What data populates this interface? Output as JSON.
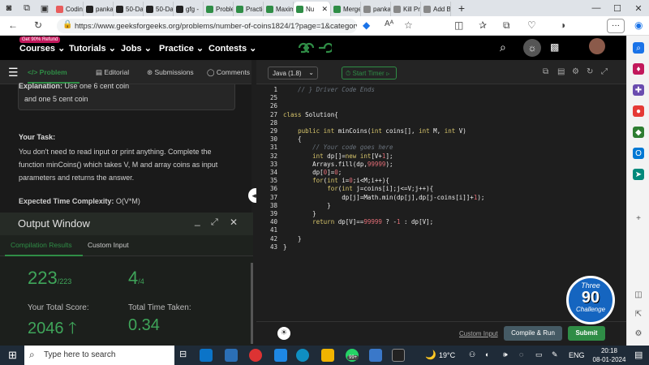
{
  "browser": {
    "tabs": [
      {
        "label": "Codin",
        "icon": "bookmark-icon",
        "color": "#e85c5c"
      },
      {
        "label": "panka",
        "icon": "github-icon",
        "color": "#222222"
      },
      {
        "label": "50-Da",
        "icon": "github-icon",
        "color": "#222222"
      },
      {
        "label": "50-Da",
        "icon": "github-icon",
        "color": "#222222"
      },
      {
        "label": "gfg - ",
        "icon": "github-icon",
        "color": "#222222"
      },
      {
        "label": "Proble",
        "icon": "gfg-icon",
        "color": "#2f8d46"
      },
      {
        "label": "Practic",
        "icon": "gfg-icon",
        "color": "#2f8d46"
      },
      {
        "label": "Maxim",
        "icon": "gfg-icon",
        "color": "#2f8d46"
      },
      {
        "label": "Nu",
        "icon": "gfg-icon",
        "color": "#2f8d46"
      },
      {
        "label": "Merge",
        "icon": "gfg-icon",
        "color": "#2f8d46"
      },
      {
        "label": "panka",
        "icon": "link-icon",
        "color": "#888888"
      },
      {
        "label": "Kill Pr",
        "icon": "link-icon",
        "color": "#888888"
      },
      {
        "label": "Add B",
        "icon": "link-icon",
        "color": "#888888"
      }
    ],
    "url": "https://www.geeksforgeeks.org/problems/number-of-coins1824/1?page=1&category=..."
  },
  "gfg": {
    "promo_badge": "Get 90% Refund",
    "nav": [
      "Courses",
      "Tutorials",
      "Jobs",
      "Practice",
      "Contests"
    ]
  },
  "left": {
    "tabs": [
      "Problem",
      "Editorial",
      "Submissions",
      "Comments"
    ],
    "explanation_label": "Explanation:",
    "explanation_text": "Use one 6 cent coin",
    "explanation_line2": "and one 5 cent coin",
    "your_task_heading": "Your Task:",
    "task_lines": [
      "You don't need to read input or print anything. Complete the",
      "function minCoins() which takes V, M and array coins as input",
      "parameters and returns the answer."
    ],
    "complexity_label": "Expected Time Complexity:",
    "complexity_value": "O(V*M)"
  },
  "output": {
    "title": "Output Window",
    "tabs": [
      "Compilation Results",
      "Custom Input"
    ],
    "tests_passed": "223",
    "tests_total": "/223",
    "attempts": "4",
    "attempts_total": "/4",
    "score_label": "Your Total Score:",
    "score_value": "2046",
    "time_label": "Total Time Taken:",
    "time_value": "0.34"
  },
  "editor": {
    "language": "Java (1.8)",
    "timer_label": "Start Timer",
    "custom_input_link": "Custom Input",
    "compile_label": "Compile & Run",
    "submit_label": "Submit",
    "line_numbers": [
      "1",
      "25",
      "26",
      "27",
      "28",
      "29",
      "30",
      "31",
      "32",
      "33",
      "34",
      "35",
      "36",
      "37",
      "38",
      "39",
      "40",
      "41",
      "42",
      "43"
    ],
    "code_lines": [
      "    // } Driver Code Ends",
      "",
      "",
      "class Solution{",
      "",
      "    public int minCoins(int coins[], int M, int V)",
      "    {",
      "        // Your code goes here",
      "        int dp[]=new int[V+1];",
      "        Arrays.fill(dp,99999);",
      "        dp[0]=0;",
      "        for(int i=0;i<M;i++){",
      "            for(int j=coins[i];j<=V;j++){",
      "                dp[j]=Math.min(dp[j],dp[j-coins[i]]+1);",
      "            }",
      "        }",
      "        return dp[V]==99999 ? -1 : dp[V];",
      "",
      "    }",
      "}"
    ]
  },
  "challenge": {
    "top": "Three",
    "number": "90",
    "bottom": "Challenge"
  },
  "taskbar": {
    "search_placeholder": "Type here to search",
    "notif_badge": "99+",
    "weather": "19°C",
    "language": "ENG",
    "time": "20:18",
    "date": "08-01-2024"
  }
}
